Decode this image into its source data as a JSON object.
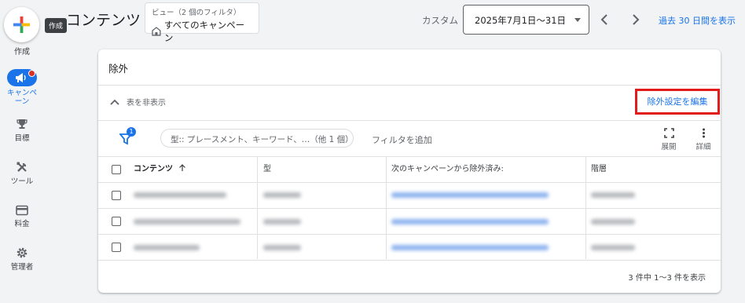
{
  "rail": {
    "create_label": "作成",
    "tooltip": "作成",
    "items": [
      {
        "label": "キャンペーン",
        "icon": "megaphone-icon",
        "active": true
      },
      {
        "label": "目標",
        "icon": "trophy-icon",
        "active": false
      },
      {
        "label": "ツール",
        "icon": "tools-icon",
        "active": false
      },
      {
        "label": "料金",
        "icon": "billing-card-icon",
        "active": false
      },
      {
        "label": "管理者",
        "icon": "gear-icon",
        "active": false
      }
    ]
  },
  "header": {
    "title": "コンテンツ",
    "view_small": "ビュー（2 個のフィルタ）",
    "view_main": "すべてのキャンペーン",
    "custom_label": "カスタム",
    "date_range": "2025年7月1日〜31日",
    "last30_label": "過去 30 日間を表示"
  },
  "card": {
    "title": "除外",
    "collapse_label": "表を非表示",
    "edit_button": "除外設定を編集",
    "filter_badge": "1",
    "filter_chip": "型:: プレースメント、キーワード、…（他 1 個）",
    "add_filter": "フィルタを追加",
    "expand_label": "展開",
    "detail_label": "詳細",
    "columns": [
      "コンテンツ",
      "型",
      "次のキャンペーンから除外済み:",
      "階層"
    ],
    "footer": "3 件中 1〜3 件を表示"
  },
  "colors": {
    "accent": "#1a73e8",
    "highlight_border": "#e21b1b",
    "notification_dot": "#d93025"
  }
}
